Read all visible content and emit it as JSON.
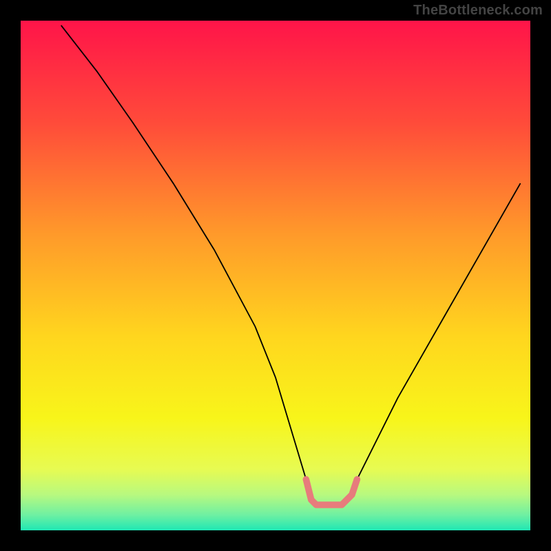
{
  "watermark": "TheBottleneck.com",
  "chart_data": {
    "type": "line",
    "title": "",
    "xlabel": "",
    "ylabel": "",
    "xlim": [
      0,
      100
    ],
    "ylim": [
      0,
      100
    ],
    "grid": false,
    "legend": false,
    "series": [
      {
        "name": "black-curve",
        "color": "#000000",
        "x": [
          8,
          15,
          22,
          30,
          38,
          46,
          50,
          53,
          56,
          57,
          58,
          60,
          63,
          65,
          66,
          68,
          74,
          82,
          90,
          98
        ],
        "values": [
          99,
          90,
          80,
          68,
          55,
          40,
          30,
          20,
          10,
          6,
          5,
          5,
          5,
          7,
          10,
          14,
          26,
          40,
          54,
          68
        ]
      },
      {
        "name": "pink-segment",
        "color": "#e77c7c",
        "x": [
          56,
          57,
          58,
          60,
          63,
          65,
          66
        ],
        "values": [
          10,
          6,
          5,
          5,
          5,
          7,
          10
        ]
      }
    ],
    "background_gradient": {
      "orientation": "vertical",
      "stops": [
        {
          "offset": 0.0,
          "color": "#ff1449"
        },
        {
          "offset": 0.2,
          "color": "#ff4b3a"
        },
        {
          "offset": 0.42,
          "color": "#ff9a2a"
        },
        {
          "offset": 0.62,
          "color": "#ffd61e"
        },
        {
          "offset": 0.78,
          "color": "#f8f51a"
        },
        {
          "offset": 0.88,
          "color": "#e7fb52"
        },
        {
          "offset": 0.93,
          "color": "#b8f97f"
        },
        {
          "offset": 0.97,
          "color": "#6ef0a2"
        },
        {
          "offset": 1.0,
          "color": "#1fe7b4"
        }
      ]
    }
  }
}
